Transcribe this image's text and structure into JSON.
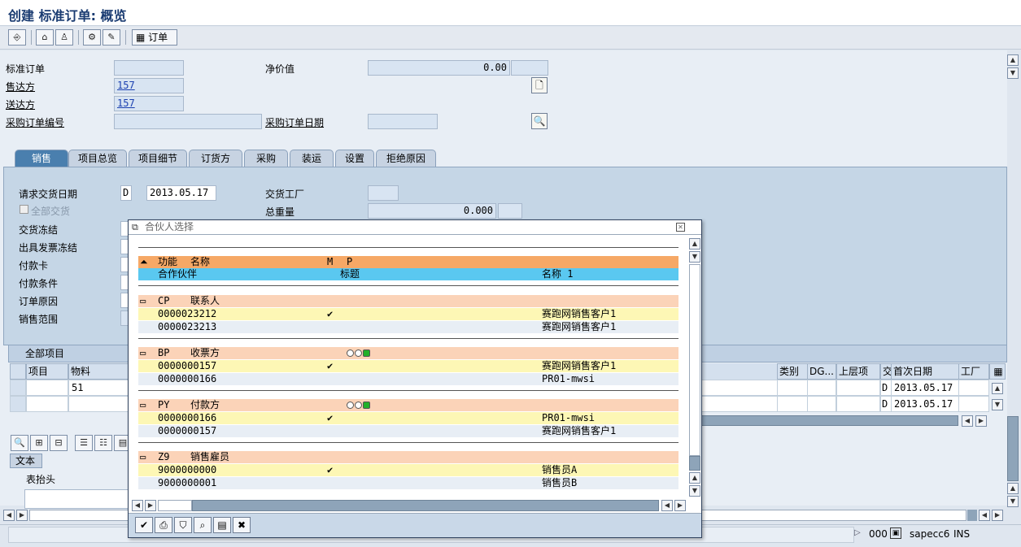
{
  "window": {
    "title": "创建 标准订单: 概览"
  },
  "toolbar": {
    "order_label": "订单"
  },
  "header": {
    "std_order_label": "标准订单",
    "std_order_value": "",
    "net_value_label": "净价值",
    "net_value": "0.00",
    "currency": "",
    "sold_to_label": "售达方",
    "sold_to_value": "157",
    "ship_to_label": "送达方",
    "ship_to_value": "157",
    "po_number_label": "采购订单编号",
    "po_number_value": "",
    "po_date_label": "采购订单日期",
    "po_date_value": ""
  },
  "tabs": [
    "销售",
    "项目总览",
    "项目细节",
    "订货方",
    "采购",
    "装运",
    "设置",
    "拒绝原因"
  ],
  "sales_tab": {
    "req_delivery_date_label": "请求交货日期",
    "req_delivery_date_unit": "D",
    "req_delivery_date": "2013.05.17",
    "delivery_plant_label": "交货工厂",
    "delivery_plant_value": "",
    "complete_delivery_label": "全部交货",
    "total_weight_label": "总重量",
    "total_weight": "0.000",
    "delivery_block_label": "交货冻结",
    "billing_block_label": "出具发票冻结",
    "payment_card_label": "付款卡",
    "payment_terms_label": "付款条件",
    "order_reason_label": "订单原因",
    "sales_area_label": "销售范围"
  },
  "items": {
    "title": "全部项目",
    "columns": {
      "item": "项目",
      "material": "物料",
      "category": "类别",
      "dg": "DG...",
      "higher_item": "上层项",
      "deliv": "交",
      "first_date": "首次日期",
      "plant": "工厂"
    },
    "rows": [
      {
        "item": "",
        "material": "51",
        "deliv": "D",
        "first_date": "2013.05.17"
      },
      {
        "item": "",
        "material": "",
        "deliv": "D",
        "first_date": "2013.05.17"
      }
    ]
  },
  "text_panel": {
    "tab": "文本",
    "header_text": "表抬头"
  },
  "status": {
    "session": "000",
    "system": "sapecc6",
    "mode": "INS"
  },
  "dialog": {
    "title": "合伙人选择",
    "header1": {
      "func": "功能",
      "name": "名称",
      "m": "M",
      "p": "P"
    },
    "header2": {
      "partner": "合作伙伴",
      "title": "标题",
      "name1": "名称 1"
    },
    "groups": [
      {
        "code": "CP",
        "name": "联系人",
        "lights": false,
        "rows": [
          {
            "id": "0000023212",
            "check": "✔",
            "name": "赛跑网销售客户1"
          },
          {
            "id": "0000023213",
            "check": "",
            "name": "赛跑网销售客户1"
          }
        ]
      },
      {
        "code": "BP",
        "name": "收票方",
        "lights": true,
        "rows": [
          {
            "id": "0000000157",
            "check": "✔",
            "name": "赛跑网销售客户1"
          },
          {
            "id": "0000000166",
            "check": "",
            "name": "PR01-mwsi"
          }
        ]
      },
      {
        "code": "PY",
        "name": "付款方",
        "lights": true,
        "rows": [
          {
            "id": "0000000166",
            "check": "✔",
            "name": "PR01-mwsi"
          },
          {
            "id": "0000000157",
            "check": "",
            "name": "赛跑网销售客户1"
          }
        ]
      },
      {
        "code": "Z9",
        "name": "销售雇员",
        "lights": false,
        "rows": [
          {
            "id": "9000000000",
            "check": "✔",
            "name": "销售员A"
          },
          {
            "id": "9000000001",
            "check": "",
            "name": "销售员B"
          }
        ]
      }
    ]
  },
  "colors": {
    "title": "#1b3c72",
    "active_tab": "#4a7fae",
    "group_row": "#fbd3b8",
    "selected_row": "#fdf7b5",
    "header_orange": "#f6a866",
    "header_blue": "#5ac8f0"
  }
}
